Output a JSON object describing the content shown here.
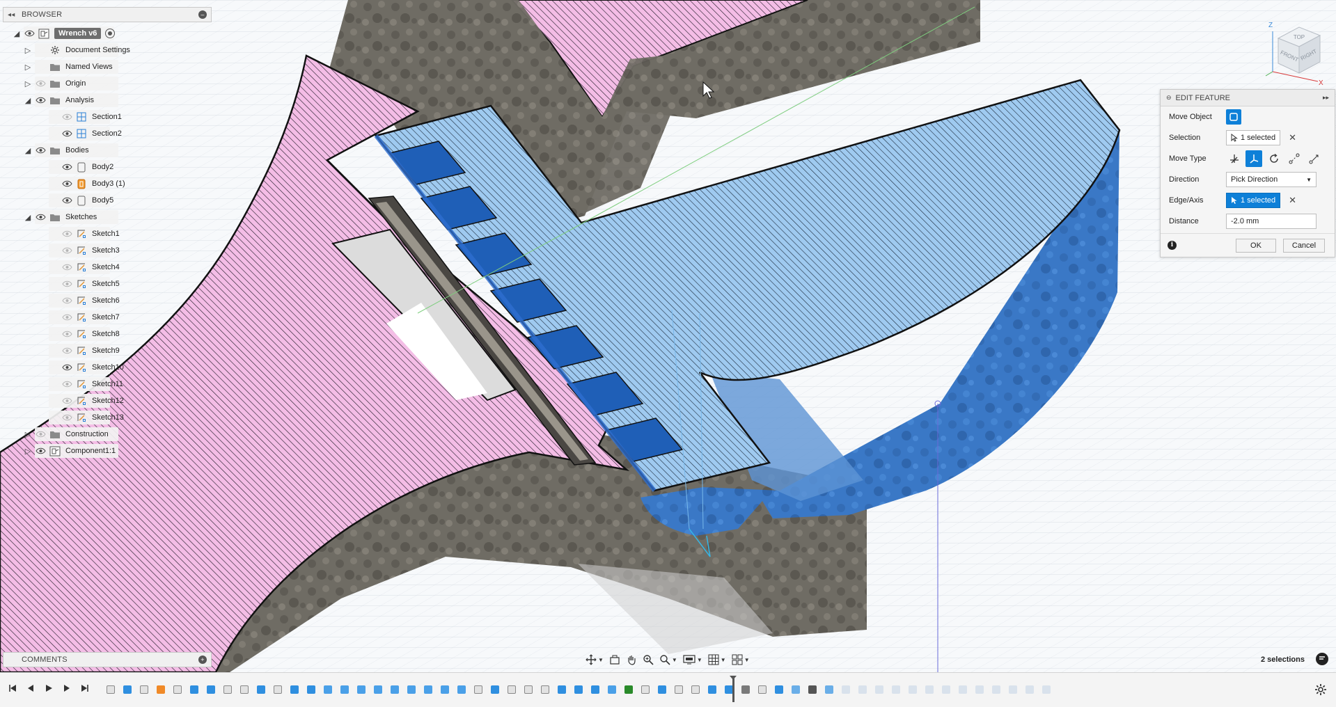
{
  "browser": {
    "header": "BROWSER",
    "tree": [
      {
        "label": "Wrench v6",
        "level": 0,
        "expander": "open",
        "eye": "on",
        "icon": "component-icon",
        "active": true
      },
      {
        "label": "Document Settings",
        "level": 1,
        "expander": "closed",
        "eye": "none",
        "icon": "gear-icon"
      },
      {
        "label": "Named Views",
        "level": 1,
        "expander": "closed",
        "eye": "none",
        "icon": "folder-icon"
      },
      {
        "label": "Origin",
        "level": 1,
        "expander": "closed",
        "eye": "off",
        "icon": "folder-icon"
      },
      {
        "label": "Analysis",
        "level": 1,
        "expander": "open",
        "eye": "on",
        "icon": "folder-icon"
      },
      {
        "label": "Section1",
        "level": 2,
        "expander": "none",
        "eye": "off",
        "icon": "section-icon"
      },
      {
        "label": "Section2",
        "level": 2,
        "expander": "none",
        "eye": "on",
        "icon": "section-icon"
      },
      {
        "label": "Bodies",
        "level": 1,
        "expander": "open",
        "eye": "on",
        "icon": "folder-icon"
      },
      {
        "label": "Body2",
        "level": 2,
        "expander": "none",
        "eye": "on",
        "icon": "body-icon"
      },
      {
        "label": "Body3 (1)",
        "level": 2,
        "expander": "none",
        "eye": "on",
        "icon": "body-orange-icon"
      },
      {
        "label": "Body5",
        "level": 2,
        "expander": "none",
        "eye": "on",
        "icon": "body-icon"
      },
      {
        "label": "Sketches",
        "level": 1,
        "expander": "open",
        "eye": "on",
        "icon": "folder-icon"
      },
      {
        "label": "Sketch1",
        "level": 2,
        "expander": "none",
        "eye": "off",
        "icon": "sketch-icon"
      },
      {
        "label": "Sketch3",
        "level": 2,
        "expander": "none",
        "eye": "off",
        "icon": "sketch-icon"
      },
      {
        "label": "Sketch4",
        "level": 2,
        "expander": "none",
        "eye": "off",
        "icon": "sketch-icon"
      },
      {
        "label": "Sketch5",
        "level": 2,
        "expander": "none",
        "eye": "off",
        "icon": "sketch-icon"
      },
      {
        "label": "Sketch6",
        "level": 2,
        "expander": "none",
        "eye": "off",
        "icon": "sketch-icon"
      },
      {
        "label": "Sketch7",
        "level": 2,
        "expander": "none",
        "eye": "off",
        "icon": "sketch-icon"
      },
      {
        "label": "Sketch8",
        "level": 2,
        "expander": "none",
        "eye": "off",
        "icon": "sketch-icon"
      },
      {
        "label": "Sketch9",
        "level": 2,
        "expander": "none",
        "eye": "off",
        "icon": "sketch-icon"
      },
      {
        "label": "Sketch10",
        "level": 2,
        "expander": "none",
        "eye": "on",
        "icon": "sketch-icon"
      },
      {
        "label": "Sketch11",
        "level": 2,
        "expander": "none",
        "eye": "off",
        "icon": "sketch-icon"
      },
      {
        "label": "Sketch12",
        "level": 2,
        "expander": "none",
        "eye": "off",
        "icon": "sketch-icon"
      },
      {
        "label": "Sketch13",
        "level": 2,
        "expander": "none",
        "eye": "off",
        "icon": "sketch-icon"
      },
      {
        "label": "Construction",
        "level": 1,
        "expander": "closed",
        "eye": "off",
        "icon": "folder-icon"
      },
      {
        "label": "Component1:1",
        "level": 1,
        "expander": "closed",
        "eye": "on",
        "icon": "component-icon"
      }
    ]
  },
  "comments": {
    "header": "COMMENTS"
  },
  "edit_feature": {
    "header": "EDIT FEATURE",
    "move_object_label": "Move Object",
    "selection_label": "Selection",
    "selection_value": "1 selected",
    "move_type_label": "Move Type",
    "move_types": [
      "free-move-icon",
      "translate-icon",
      "rotate-icon",
      "point-to-point-icon",
      "point-to-position-icon"
    ],
    "move_type_selected": 1,
    "direction_label": "Direction",
    "direction_value": "Pick Direction",
    "edge_axis_label": "Edge/Axis",
    "edge_axis_value": "1 selected",
    "distance_label": "Distance",
    "distance_value": "-2.0 mm",
    "ok_label": "OK",
    "cancel_label": "Cancel"
  },
  "viewcube": {
    "top": "TOP",
    "front": "FRONT",
    "right": "RIGHT",
    "axis_x": "X",
    "axis_z": "Z"
  },
  "status": {
    "selections": "2 selections"
  },
  "colors": {
    "selected_blue": "#0e80d8",
    "body_blue": "#3f7fcf",
    "section_light_blue": "#a8d0f0",
    "section_pink": "#f3b8e4",
    "stone_grey": "#6d6a63",
    "timeline_bg": "#f4f4f4"
  },
  "timeline": {
    "features": [
      "sketch",
      "extrude",
      "sketch",
      "body",
      "sketch",
      "extrude",
      "extrude",
      "sketch",
      "sketch",
      "extrude",
      "sketch",
      "extrude",
      "revolve",
      "fillet",
      "fillet",
      "chamfer",
      "loft",
      "fillet",
      "fillet",
      "fillet",
      "fillet",
      "fillet",
      "sketch",
      "extrude",
      "sketch",
      "sketch",
      "sketch",
      "extrude",
      "extrude",
      "extrude",
      "fillet",
      "combine",
      "sketch",
      "extrude",
      "sketch",
      "sketch",
      "extrude",
      "extrude",
      "offset",
      "sketch",
      "extrude",
      "section",
      "move",
      "section",
      "suppressed",
      "suppressed",
      "suppressed",
      "suppressed",
      "suppressed",
      "suppressed",
      "suppressed",
      "suppressed",
      "suppressed",
      "suppressed",
      "suppressed",
      "suppressed",
      "suppressed"
    ]
  }
}
